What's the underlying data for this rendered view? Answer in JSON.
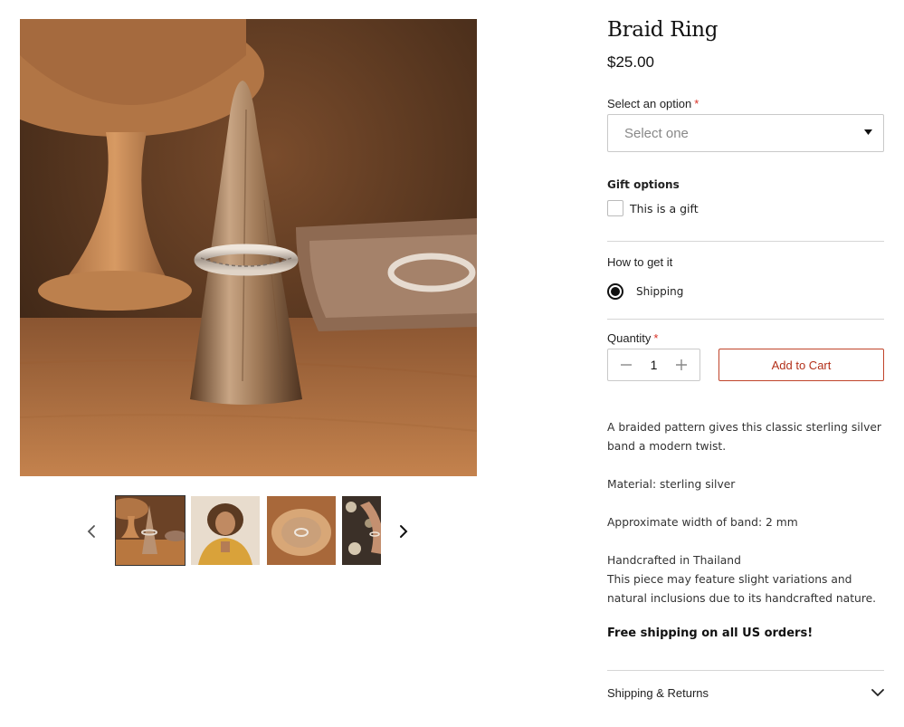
{
  "product": {
    "title": "Braid Ring",
    "price": "$25.00"
  },
  "option": {
    "label": "Select an option",
    "required_mark": "*",
    "placeholder": "Select one"
  },
  "gift": {
    "label": "Gift options",
    "checkbox_label": "This is a gift",
    "checked": false
  },
  "delivery": {
    "label": "How to get it",
    "method": "Shipping",
    "selected": true
  },
  "quantity": {
    "label": "Quantity",
    "required_mark": "*",
    "value": "1"
  },
  "cart": {
    "button_label": "Add to Cart"
  },
  "description": {
    "line1": "A braided pattern gives this classic sterling silver band a modern twist.",
    "line2": "Material: sterling silver",
    "line3": "Approximate width of band: 2 mm",
    "line4": "Handcrafted in Thailand",
    "line5": "This piece may feature slight variations and natural inclusions due to its handcrafted nature."
  },
  "promo": "Free shipping on all US orders!",
  "accordion": {
    "label": "Shipping & Returns"
  },
  "gallery": {
    "thumbnail_count": 4,
    "active_index": 0
  },
  "colors": {
    "accent": "#b3301a",
    "required": "#d93025"
  }
}
